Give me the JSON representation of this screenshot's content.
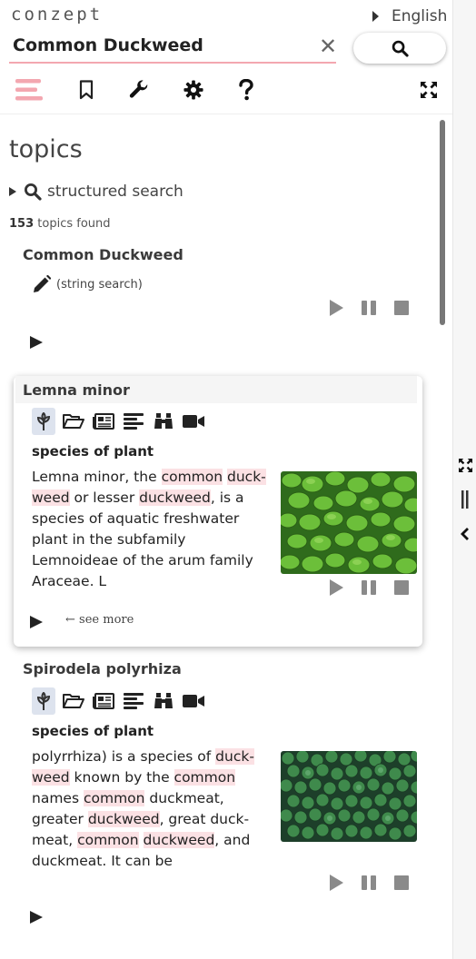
{
  "app": {
    "brand": "conzept",
    "language": "English"
  },
  "search": {
    "value": "Common Duckweed",
    "clear_symbol": "✕"
  },
  "toolbar": {
    "icons": [
      "menu-icon",
      "bookmark-icon",
      "wrench-icon",
      "gear-icon",
      "question-icon",
      "fullscreen-icon"
    ]
  },
  "main": {
    "heading": "topics",
    "structured_search_label": "structured search",
    "found_count": "153",
    "found_text": " topics found"
  },
  "string_result": {
    "title": "Common Duckweed",
    "note": "(string search)"
  },
  "results": [
    {
      "title": "Lemna minor",
      "subtitle": "species of plant",
      "description_parts": [
        {
          "t": "Lemna minor, the ",
          "hl": false
        },
        {
          "t": "common",
          "hl": true
        },
        {
          "t": " ",
          "hl": false
        },
        {
          "t": "duck-",
          "hl": true
        },
        {
          "t": "weed",
          "hl": true
        },
        {
          "t": " or lesser ",
          "hl": false
        },
        {
          "t": "duckweed",
          "hl": true
        },
        {
          "t": ", is a species of aquatic freshwater plant in the subfamily Lemnoideae of the arum family Araceae. L",
          "hl": false
        }
      ],
      "see_more": "see more",
      "image_color": "#4f9a2a"
    },
    {
      "title": "Spirodela polyrhiza",
      "subtitle": "species of plant",
      "description_parts": [
        {
          "t": "polyrrhiza) is a species of ",
          "hl": false
        },
        {
          "t": "duck-",
          "hl": true
        },
        {
          "t": "weed",
          "hl": true
        },
        {
          "t": " known by the ",
          "hl": false
        },
        {
          "t": "common",
          "hl": true
        },
        {
          "t": " names ",
          "hl": false
        },
        {
          "t": "common",
          "hl": true
        },
        {
          "t": " duckmeat, greater ",
          "hl": false
        },
        {
          "t": "duckweed",
          "hl": true
        },
        {
          "t": ", great duck-meat, ",
          "hl": false
        },
        {
          "t": "common",
          "hl": true
        },
        {
          "t": " ",
          "hl": false
        },
        {
          "t": "duckweed",
          "hl": true
        },
        {
          "t": ", and duckmeat. It can be",
          "hl": false
        }
      ],
      "image_color": "#2f6b3a"
    }
  ],
  "colors": {
    "accent_pink": "#f3a7b0",
    "highlight": "#fbe1e4",
    "icon": "#222222",
    "media_icon": "#8a8a8a"
  }
}
